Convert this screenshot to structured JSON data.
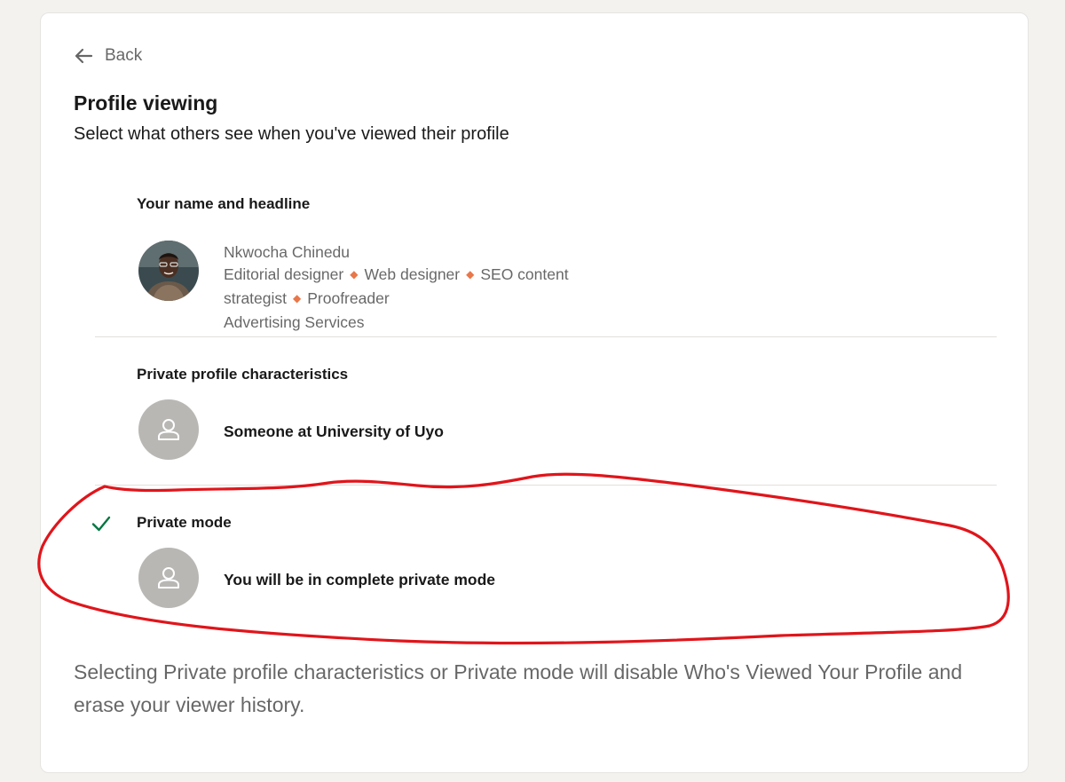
{
  "back": {
    "label": "Back",
    "icon": "arrow-left-icon"
  },
  "header": {
    "title": "Profile viewing",
    "subtitle": "Select what others see when you've viewed their profile"
  },
  "options": [
    {
      "label": "Your name and headline",
      "selected": false,
      "avatar": "profile-photo",
      "lines": [
        "Nkwocha Chinedu",
        "Editorial designer",
        "Web designer",
        "SEO content",
        "strategist",
        "Proofreader",
        "Advertising Services"
      ]
    },
    {
      "label": "Private profile characteristics",
      "selected": false,
      "avatar": "ghost-person-icon",
      "description": "Someone at University of Uyo"
    },
    {
      "label": "Private mode",
      "selected": true,
      "avatar": "ghost-person-icon",
      "description": "You will be in complete private mode"
    }
  ],
  "footnote": "Selecting Private profile characteristics or Private mode will disable Who's Viewed Your Profile and erase your viewer history.",
  "colors": {
    "page_background": "#f3f2ef",
    "card_background": "#ffffff",
    "check_green": "#057642",
    "separator_orange": "#e8774a",
    "annotation_red": "#e0151b"
  },
  "icons": {
    "selected_indicator": "checkmark-icon",
    "headline_separator": "diamond-separator-icon"
  }
}
